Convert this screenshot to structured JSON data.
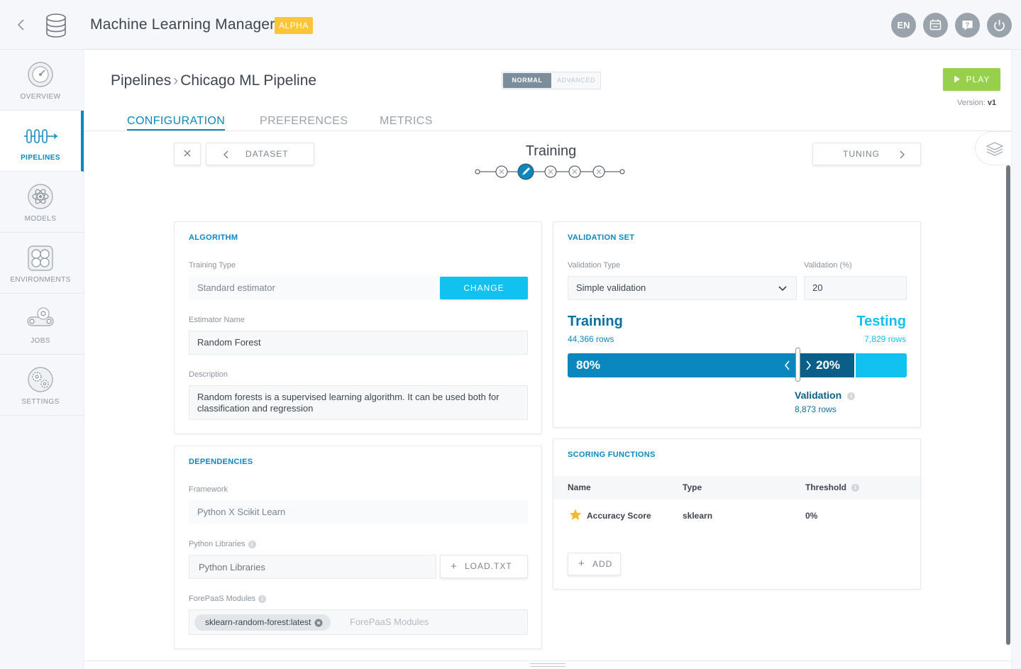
{
  "app": {
    "title": "Machine Learning Manager",
    "badge": "ALPHA"
  },
  "top_icons": {
    "lang": "EN"
  },
  "sidebar": {
    "items": [
      {
        "label": "OVERVIEW",
        "icon": "speedometer-icon"
      },
      {
        "label": "PIPELINES",
        "icon": "pipeline-icon"
      },
      {
        "label": "MODELS",
        "icon": "atom-icon"
      },
      {
        "label": "ENVIRONMENTS",
        "icon": "environment-icon"
      },
      {
        "label": "JOBS",
        "icon": "conveyor-icon"
      },
      {
        "label": "SETTINGS",
        "icon": "gears-icon"
      }
    ]
  },
  "header": {
    "breadcrumb_root": "Pipelines",
    "breadcrumb_current": "Chicago ML Pipeline",
    "mode_normal": "NORMAL",
    "mode_advanced": "ADVANCED",
    "play_label": "PLAY",
    "version_label": "Version:",
    "version_value": "v1"
  },
  "tabs": [
    "CONFIGURATION",
    "PREFERENCES",
    "METRICS"
  ],
  "step_nav": {
    "prev_label": "DATASET",
    "title": "Training",
    "next_label": "TUNING"
  },
  "algorithm": {
    "title": "ALGORITHM",
    "training_type_label": "Training Type",
    "training_type_value": "Standard estimator",
    "change_label": "CHANGE",
    "estimator_label": "Estimator Name",
    "estimator_value": "Random Forest",
    "description_label": "Description",
    "description_value": "Random forests is a supervised learning algorithm. It can be used both for classification and regression"
  },
  "dependencies": {
    "title": "DEPENDENCIES",
    "framework_label": "Framework",
    "framework_value": "Python X Scikit Learn",
    "libraries_label": "Python Libraries",
    "libraries_placeholder": "Python Libraries",
    "load_txt_label": "LOAD.TXT",
    "modules_label": "ForePaaS Modules",
    "module_tag": "sklearn-random-forest:latest",
    "modules_placeholder": "ForePaaS Modules"
  },
  "validation": {
    "title": "VALIDATION SET",
    "type_label": "Validation Type",
    "type_value": "Simple validation",
    "percent_label": "Validation (%)",
    "percent_value": "20",
    "training_label": "Training",
    "training_rows": "44,366 rows",
    "testing_label": "Testing",
    "testing_rows": "7,829 rows",
    "training_pct": "80%",
    "validation_pct": "20%",
    "validation_label": "Validation",
    "validation_rows": "8,873 rows"
  },
  "scoring": {
    "title": "SCORING FUNCTIONS",
    "columns": [
      "Name",
      "Type",
      "Threshold"
    ],
    "rows": [
      {
        "name": "Accuracy Score",
        "type": "sklearn",
        "threshold": "0%"
      }
    ],
    "add_label": "ADD"
  },
  "colors": {
    "accent": "#0b87c0",
    "cyan": "#11c1ef",
    "play": "#97d04a",
    "alpha": "#fcc537",
    "star": "#f6b82b"
  }
}
